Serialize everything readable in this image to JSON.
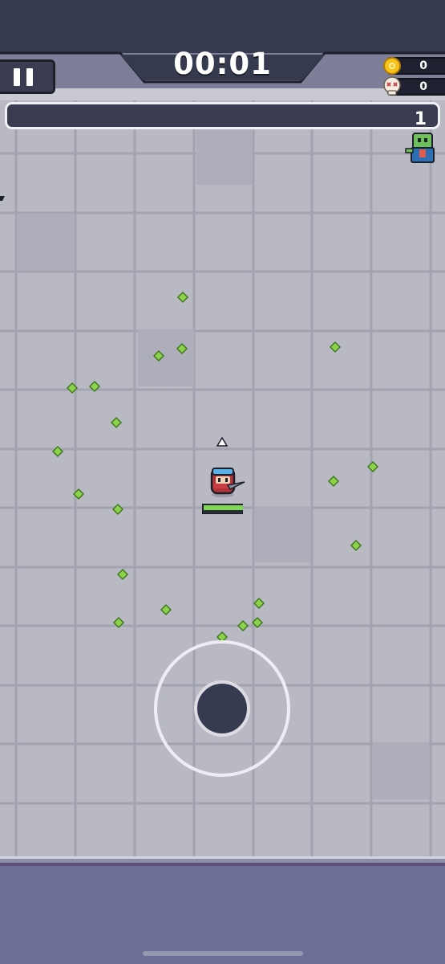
{
  "hud": {
    "timer": "00:01",
    "coins": "0",
    "kills": "0",
    "level": "1",
    "xp_progress": 0.0
  },
  "player": {
    "hp_fraction": 1.0,
    "exp_fraction": 0.0
  },
  "gems": [
    {
      "type": "xp-gem"
    },
    {
      "type": "xp-gem"
    },
    {
      "type": "xp-gem"
    },
    {
      "type": "xp-gem"
    },
    {
      "type": "xp-gem"
    },
    {
      "type": "xp-gem"
    },
    {
      "type": "xp-gem"
    },
    {
      "type": "xp-gem"
    },
    {
      "type": "xp-gem"
    },
    {
      "type": "xp-gem"
    },
    {
      "type": "xp-gem"
    },
    {
      "type": "xp-gem"
    },
    {
      "type": "xp-gem"
    },
    {
      "type": "xp-gem"
    },
    {
      "type": "xp-gem"
    },
    {
      "type": "xp-gem"
    },
    {
      "type": "xp-gem"
    },
    {
      "type": "xp-gem"
    },
    {
      "type": "xp-gem"
    },
    {
      "type": "xp-gem"
    },
    {
      "type": "xp-gem"
    }
  ],
  "colors": {
    "floor": "#b9b9c4",
    "hud_dark": "#3a3d52",
    "gem": "#8ed14b",
    "xp_green": "#7ed957",
    "coin": "#f7c21a",
    "panel": "#6c7096"
  },
  "icons": [
    "pause-icon",
    "coin-icon",
    "skull-icon",
    "direction-arrow-icon",
    "zombie-enemy",
    "ninja-player"
  ]
}
